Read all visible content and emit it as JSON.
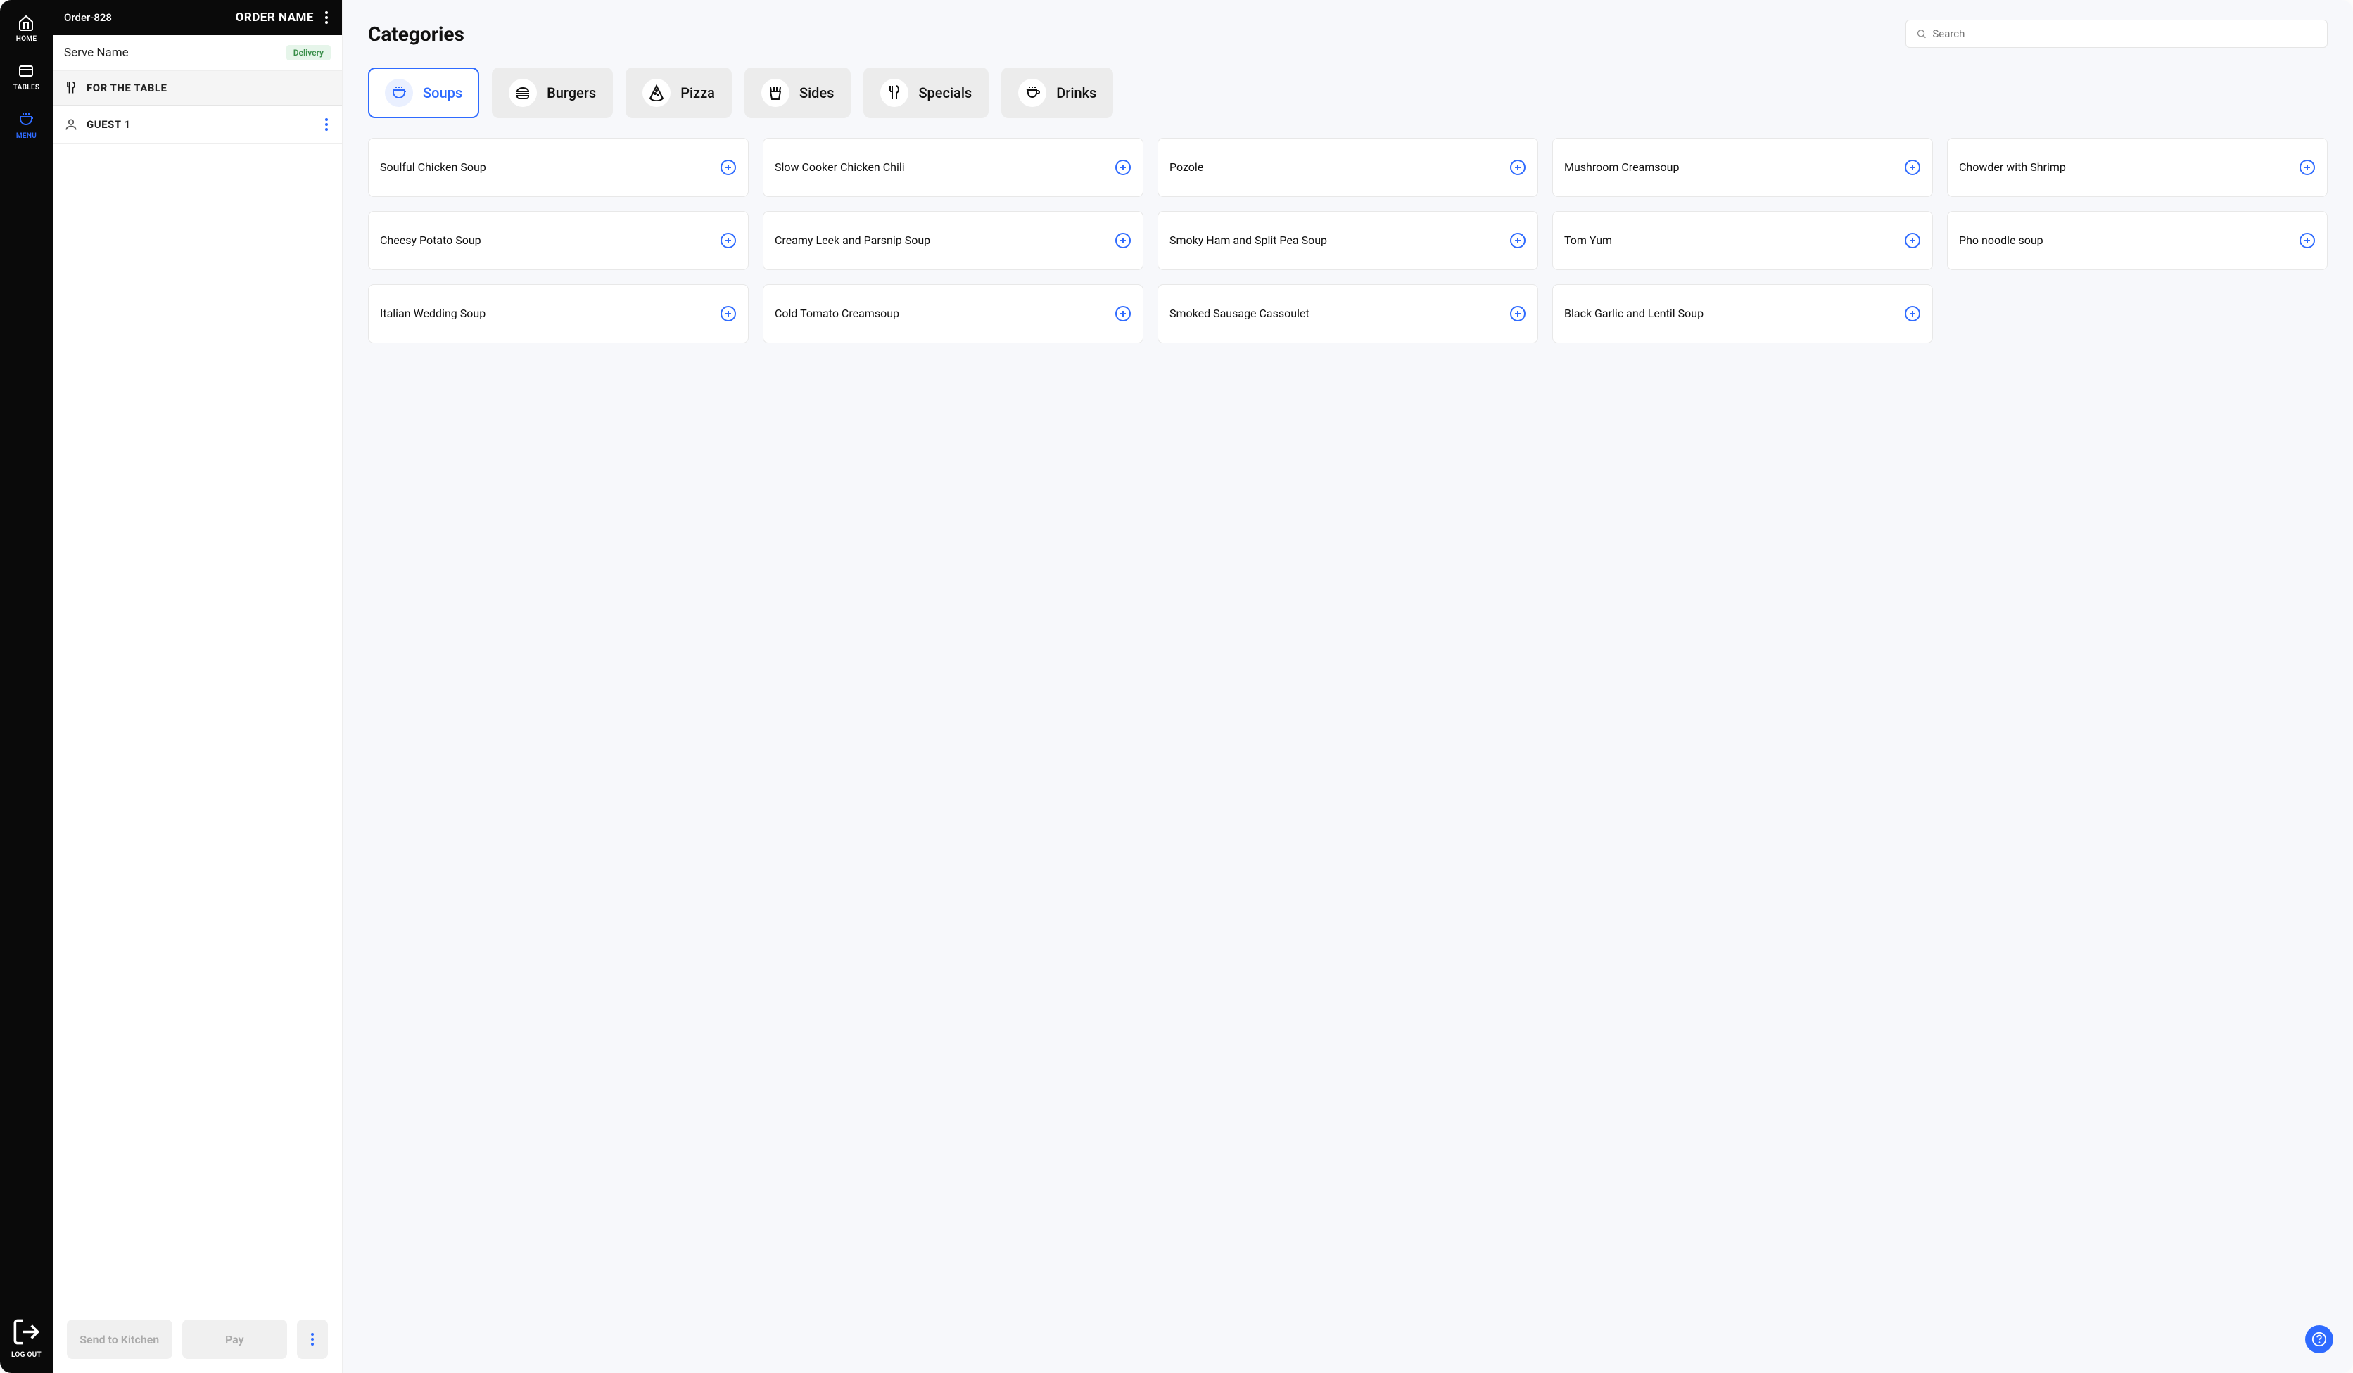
{
  "nav": {
    "home": "HOME",
    "tables": "TABLES",
    "menu": "MENU",
    "logout": "LOG OUT"
  },
  "order": {
    "id": "Order-828",
    "name_label": "ORDER NAME",
    "serve_name": "Serve Name",
    "delivery_badge": "Delivery",
    "for_table": "FOR THE TABLE",
    "guest": "GUEST 1",
    "send_kitchen": "Send to Kitchen",
    "pay": "Pay"
  },
  "main": {
    "title": "Categories",
    "search_placeholder": "Search"
  },
  "categories": [
    {
      "label": "Soups",
      "icon": "pot",
      "active": true
    },
    {
      "label": "Burgers",
      "icon": "burger",
      "active": false
    },
    {
      "label": "Pizza",
      "icon": "pizza",
      "active": false
    },
    {
      "label": "Sides",
      "icon": "fries",
      "active": false
    },
    {
      "label": "Specials",
      "icon": "utensils",
      "active": false
    },
    {
      "label": "Drinks",
      "icon": "cup",
      "active": false
    }
  ],
  "items": [
    {
      "name": "Soulful Chicken Soup"
    },
    {
      "name": "Slow Cooker Chicken Chili"
    },
    {
      "name": "Pozole"
    },
    {
      "name": "Mushroom Creamsoup"
    },
    {
      "name": "Chowder with Shrimp"
    },
    {
      "name": "Cheesy Potato Soup"
    },
    {
      "name": "Creamy Leek and Parsnip Soup"
    },
    {
      "name": "Smoky Ham and Split Pea Soup"
    },
    {
      "name": "Tom Yum"
    },
    {
      "name": "Pho noodle soup"
    },
    {
      "name": "Italian Wedding Soup"
    },
    {
      "name": "Cold Tomato Creamsoup"
    },
    {
      "name": "Smoked Sausage Cassoulet"
    },
    {
      "name": "Black Garlic and Lentil Soup"
    }
  ]
}
